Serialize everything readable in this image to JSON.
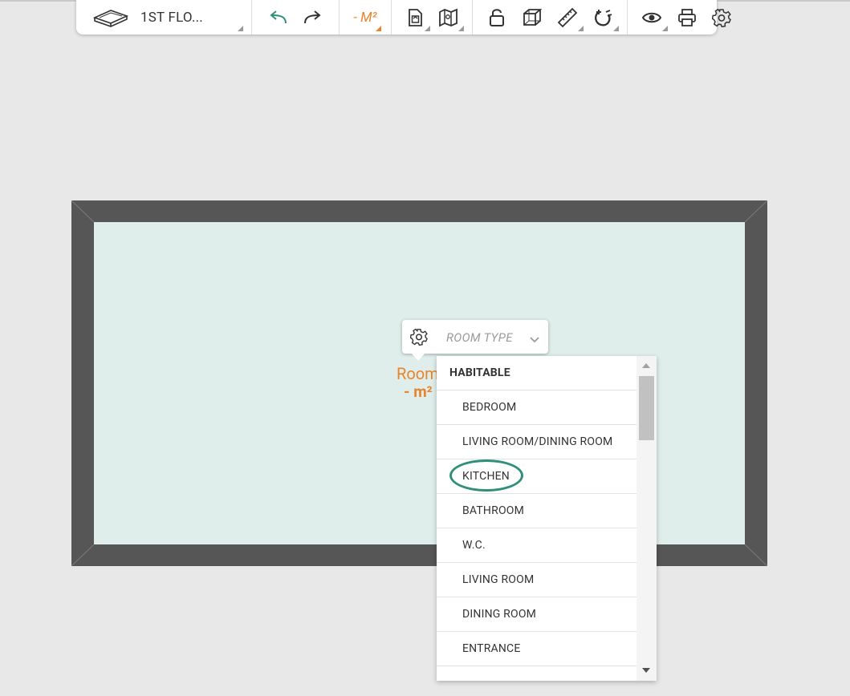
{
  "toolbar": {
    "floor_label": "1ST FLO...",
    "unit_label": "- M²",
    "icons": [
      "floor-plan-icon",
      "undo-icon",
      "redo-icon",
      "area-unit-icon",
      "document-icon",
      "map-icon",
      "unlock-icon",
      "3d-cube-icon",
      "ruler-icon",
      "magnet-icon",
      "eye-icon",
      "print-icon",
      "settings-icon"
    ]
  },
  "room": {
    "name": "Room",
    "area": "- m²"
  },
  "room_type": {
    "label": "ROOM TYPE"
  },
  "dropdown": {
    "header": "HABITABLE",
    "items": [
      "BEDROOM",
      "LIVING ROOM/DINING ROOM",
      "KITCHEN",
      "BATHROOM",
      "W.C.",
      "LIVING ROOM",
      "DINING ROOM",
      "ENTRANCE"
    ],
    "highlighted": "KITCHEN"
  },
  "colors": {
    "accent_orange": "#e8842c",
    "wall": "#565656",
    "floor": "#dfeeeb",
    "highlight_ring": "#2f8f7a",
    "undo_green": "#2f8f7a"
  }
}
